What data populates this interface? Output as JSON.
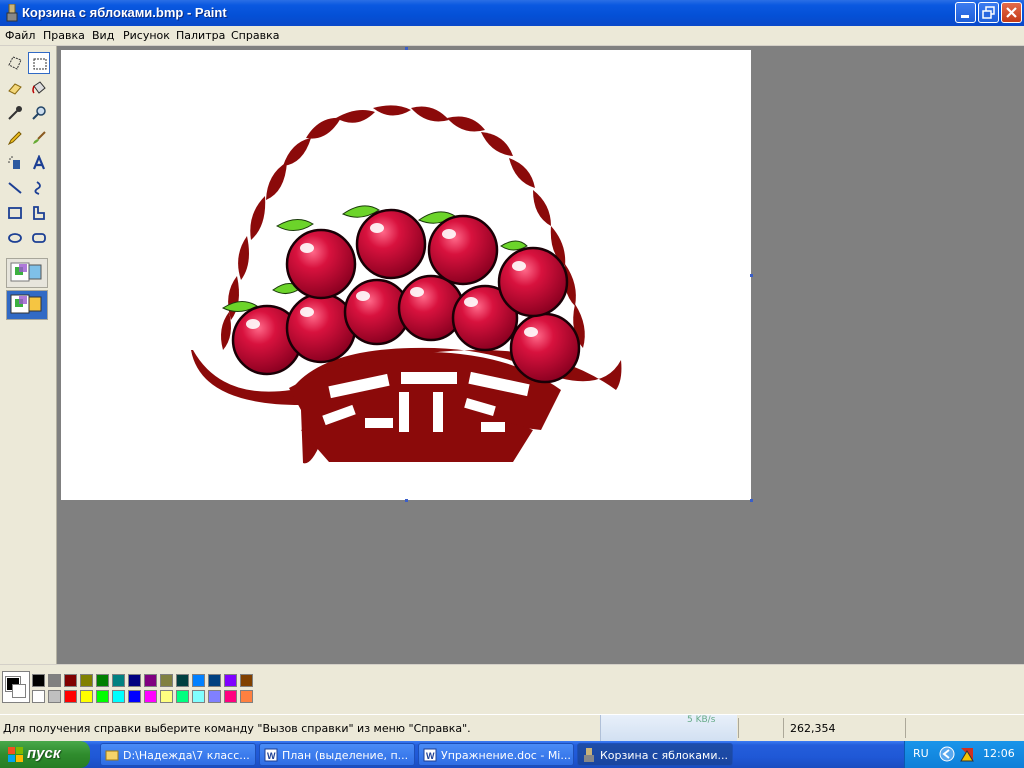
{
  "window": {
    "title": "Корзина с яблоками.bmp - Paint"
  },
  "menu": [
    "Файл",
    "Правка",
    "Вид",
    "Рисунок",
    "Палитра",
    "Справка"
  ],
  "tools": [
    {
      "name": "free-select-icon"
    },
    {
      "name": "rect-select-icon"
    },
    {
      "name": "eraser-icon"
    },
    {
      "name": "fill-bucket-icon"
    },
    {
      "name": "color-picker-icon"
    },
    {
      "name": "magnifier-icon"
    },
    {
      "name": "pencil-icon"
    },
    {
      "name": "brush-icon"
    },
    {
      "name": "airbrush-icon"
    },
    {
      "name": "text-icon"
    },
    {
      "name": "line-icon"
    },
    {
      "name": "curve-icon"
    },
    {
      "name": "rectangle-icon"
    },
    {
      "name": "polygon-icon"
    },
    {
      "name": "ellipse-icon"
    },
    {
      "name": "rounded-rect-icon"
    }
  ],
  "palette": {
    "foreground": "#000000",
    "background": "#ffffff",
    "row1": [
      "#000000",
      "#808080",
      "#800000",
      "#808000",
      "#008000",
      "#008080",
      "#000080",
      "#800080",
      "#808040",
      "#004040",
      "#0080ff",
      "#004080",
      "#8000ff",
      "#804000"
    ],
    "row2": [
      "#ffffff",
      "#c0c0c0",
      "#ff0000",
      "#ffff00",
      "#00ff00",
      "#00ffff",
      "#0000ff",
      "#ff00ff",
      "#ffff80",
      "#00ff80",
      "#80ffff",
      "#8080ff",
      "#ff0080",
      "#ff8040"
    ]
  },
  "status": {
    "help": "Для получения справки выберите команду \"Вызов справки\" из меню \"Справка\".",
    "net_rate": "5 KB/s",
    "coords": "262,354"
  },
  "taskbar": {
    "start": "пуск",
    "tasks": [
      {
        "label": "D:\\Надежда\\7 класс..."
      },
      {
        "label": "План (выделение, п..."
      },
      {
        "label": "Упражнение.doc - Mi..."
      },
      {
        "label": "Корзина с яблоками..."
      }
    ],
    "lang": "RU",
    "clock": "12:06"
  }
}
